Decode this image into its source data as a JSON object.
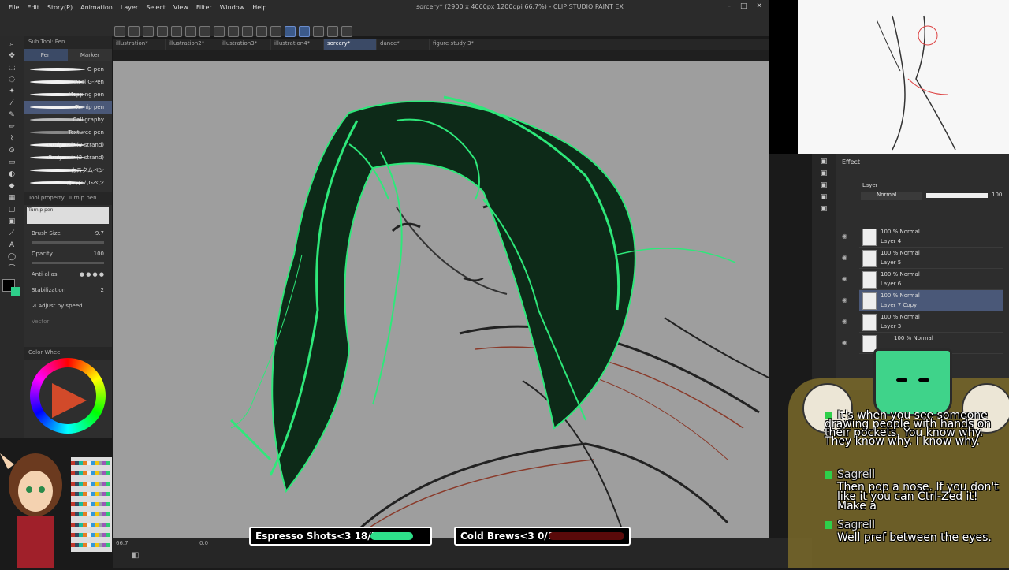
{
  "window": {
    "title": "sorcery* (2900 x 4060px 1200dpi 66.7%) - CLIP STUDIO PAINT EX"
  },
  "menu": [
    "File",
    "Edit",
    "Story(P)",
    "Animation",
    "Layer",
    "Select",
    "View",
    "Filter",
    "Window",
    "Help"
  ],
  "tabs": [
    {
      "label": "illustration*",
      "active": false
    },
    {
      "label": "illustration2*",
      "active": false
    },
    {
      "label": "illustration3*",
      "active": false
    },
    {
      "label": "illustration4*",
      "active": false
    },
    {
      "label": "sorcery*",
      "active": true
    },
    {
      "label": "dance*",
      "active": false
    },
    {
      "label": "figure study 3*",
      "active": false
    }
  ],
  "subtool": {
    "title": "Sub Tool: Pen",
    "tabs": [
      {
        "label": "Pen",
        "active": true
      },
      {
        "label": "Marker",
        "active": false
      }
    ],
    "brushes": [
      {
        "label": "G-pen",
        "active": false
      },
      {
        "label": "Real G-Pen",
        "active": false
      },
      {
        "label": "Mapping pen",
        "active": false
      },
      {
        "label": "Turnip pen",
        "active": true
      },
      {
        "label": "Calligraphy",
        "active": false
      },
      {
        "label": "Textured pen",
        "active": false
      },
      {
        "label": "Curly hair (3-strand)",
        "active": false
      },
      {
        "label": "Curly hair (2-strand)",
        "active": false
      },
      {
        "label": "カスタムペン",
        "active": false
      },
      {
        "label": "カスタムGペン",
        "active": false
      }
    ]
  },
  "toolprop": {
    "title": "Tool property: Turnip pen",
    "brush_name": "Turnip pen",
    "brush_size_label": "Brush Size",
    "brush_size": "9.7",
    "opacity_label": "Opacity",
    "opacity": "100",
    "antialias_label": "Anti-alias",
    "stabilization_label": "Stabilization",
    "stabilization": "2",
    "adjust_label": "Adjust by speed",
    "vector_label": "Vector"
  },
  "colorwheel": {
    "title": "Color Wheel",
    "accent": "#2ecf8a"
  },
  "status": {
    "zoom": "66.7",
    "angle": "0.0"
  },
  "right_panel": {
    "effect_label": "Effect",
    "layer_tab": "Layer",
    "blend_mode": "Normal",
    "opacity": "100",
    "layers": [
      {
        "mode": "100 % Normal",
        "name": "Layer 4",
        "selected": false
      },
      {
        "mode": "100 % Normal",
        "name": "Layer 5",
        "selected": false
      },
      {
        "mode": "100 % Normal",
        "name": "Layer 6",
        "selected": false
      },
      {
        "mode": "100 % Normal",
        "name": "Layer 7 Copy",
        "selected": true
      },
      {
        "mode": "100 % Normal",
        "name": "Layer 3",
        "selected": false
      },
      {
        "mode": "100 % Normal",
        "name": "",
        "selected": false
      }
    ]
  },
  "overlays": {
    "espresso": {
      "label": "Espresso Shots<3 18/50",
      "fill_fraction": 0.36,
      "color": "#2ee08a"
    },
    "coldbrew": {
      "label": "Cold Brews<3 0/10",
      "fill_fraction": 0.0,
      "color": "#c41818"
    }
  },
  "chat": [
    {
      "user": "",
      "text": "It's when you see someone drawing people with hands on their pockets. You know why. They know why. I know why."
    },
    {
      "user": "Sagrell",
      "text": "Then pop a nose. If you don't like it you can Ctrl-Zed it! Make a"
    },
    {
      "user": "Sagrell",
      "text": "Well pref between the eyes."
    }
  ],
  "colors": {
    "accent": "#3c5a8a",
    "hair_glow": "#2ee87a",
    "chat_dot": "#2ecf4a"
  }
}
